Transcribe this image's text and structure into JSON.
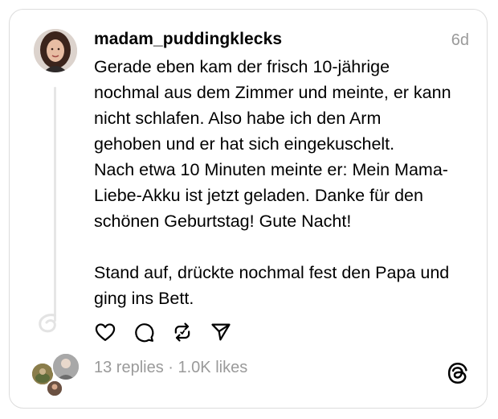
{
  "post": {
    "username": "madam_puddingklecks",
    "time": "6d",
    "text_lines": [
      "Gerade eben kam der frisch 10-jährige",
      "nochmal aus dem Zimmer und meinte, er kann",
      "nicht schlafen. Also habe ich den Arm",
      "gehoben und er hat sich eingekuschelt.",
      "Nach etwa 10 Minuten meinte er: Mein Mama-",
      "Liebe-Akku ist jetzt geladen. Danke für den",
      "schönen Geburtstag! Gute Nacht!",
      "Stand auf, drückte nochmal fest den Papa und",
      "ging ins Bett."
    ]
  },
  "stats": {
    "replies": "13 replies",
    "separator": " · ",
    "likes": "1.0K likes"
  },
  "icons": {
    "like": "heart-icon",
    "reply": "comment-icon",
    "repost": "repost-icon",
    "share": "send-icon",
    "brand": "threads-logo-icon"
  },
  "colors": {
    "text": "#000000",
    "muted": "#9a9a9a",
    "border": "#dcdcdc"
  }
}
